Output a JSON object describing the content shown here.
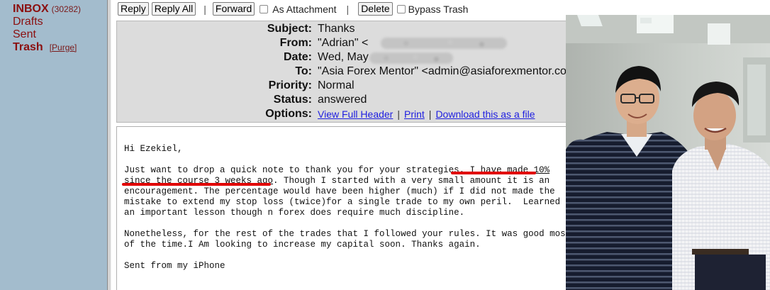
{
  "folders": {
    "inbox_label": "INBOX",
    "inbox_count": "(30282)",
    "drafts_label": "Drafts",
    "sent_label": "Sent",
    "trash_label": "Trash",
    "purge_label": "[Purge]"
  },
  "toolbar": {
    "reply_label": "Reply",
    "reply_all_label": "Reply All",
    "separator_1": "|",
    "forward_label": "Forward",
    "as_attachment_label": "As Attachment",
    "separator_2": "|",
    "delete_label": "Delete",
    "bypass_trash_label": "Bypass Trash"
  },
  "header": {
    "subject_label": "Subject:",
    "subject_value": "Thanks",
    "from_label": "From:",
    "from_value": "\"Adrian\" <",
    "date_label": "Date:",
    "date_value": "Wed, May",
    "to_label": "To:",
    "to_value": "\"Asia Forex Mentor\" <admin@asiaforexmentor.co",
    "priority_label": "Priority:",
    "priority_value": "Normal",
    "status_label": "Status:",
    "status_value": "answered",
    "options_label": "Options:",
    "view_full_header": "View Full Header",
    "options_sep_1": "|",
    "print": "Print",
    "options_sep_2": "|",
    "download": "Download this as a file"
  },
  "message": {
    "greeting": "Hi Ezekiel,",
    "p1_l1_a": "Just want to drop a quick note to thank you for your strategies. ",
    "p1_l1_b": "I have made 10%",
    "p1_l2_a": "since the course 3 weeks ago",
    "p1_l2_b": ". Though I started with a very small amount it is an",
    "p1_l3": "encouragement. The percentage would have been higher (much) if I did not made the",
    "p1_l4": "mistake to extend my stop loss (twice)for a single trade to my own peril.  Learned",
    "p1_l5": "an important lesson though n forex does require much discipline.",
    "p2_l1": "Nonetheless, for the rest of the trades that I followed your rules. It was good most",
    "p2_l2": "of the time.I Am looking to increase my capital soon. Thanks again.",
    "signature": "Sent from my iPhone"
  },
  "colors": {
    "sidebar_bg": "#a3bccd",
    "folder_text": "#8b0f0f",
    "header_bg": "#dcdcdc",
    "link": "#1e1ee0",
    "highlight_underline": "#e10000"
  }
}
